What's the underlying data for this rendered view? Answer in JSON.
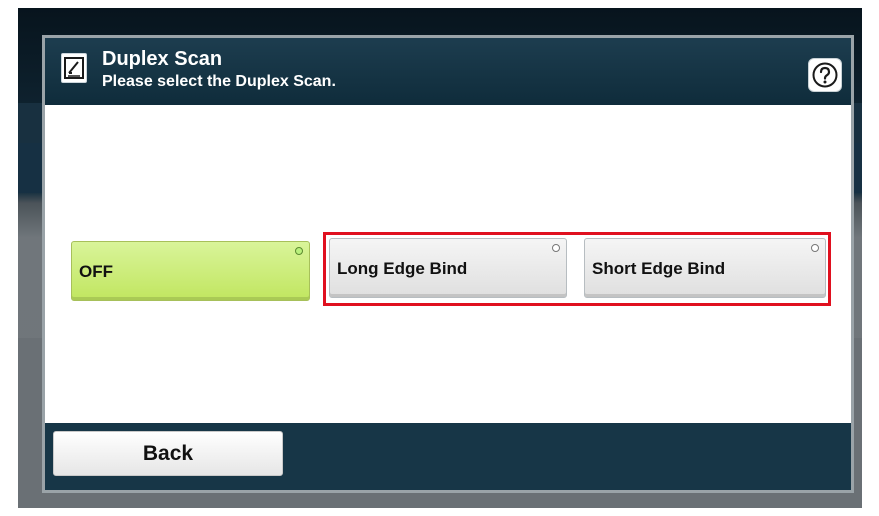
{
  "dialog": {
    "title": "Duplex Scan",
    "subtitle": "Please select the Duplex Scan.",
    "title_icon": "scan-document-icon",
    "help_icon": "help-icon"
  },
  "options": [
    {
      "label": "OFF",
      "selected": true
    },
    {
      "label": "Long Edge Bind",
      "selected": false
    },
    {
      "label": "Short Edge Bind",
      "selected": false
    }
  ],
  "footer": {
    "back_label": "Back"
  },
  "colors": {
    "selected_button": "#c8eb6a",
    "highlight_border": "#e0101f",
    "title_bar": "#163847"
  }
}
